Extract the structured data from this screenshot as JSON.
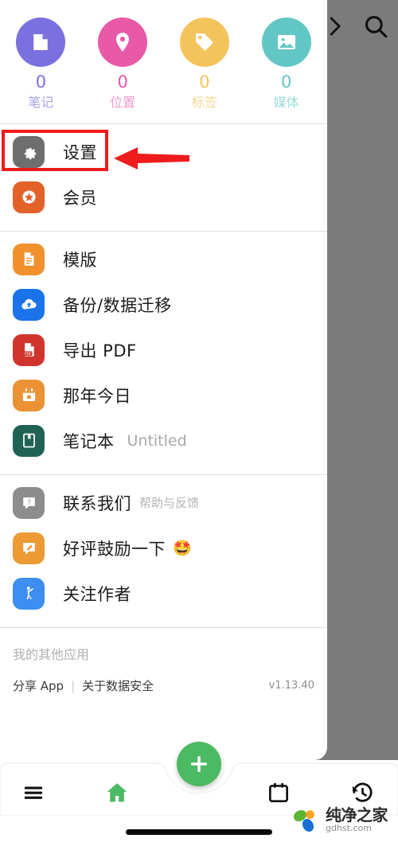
{
  "overlay": {
    "chevron_icon": "chevron-right-icon",
    "search_icon": "search-icon"
  },
  "stats": [
    {
      "icon": "note-icon",
      "count": "0",
      "label": "笔记",
      "color": "#7b70e0",
      "label_color": "#a7a1e6"
    },
    {
      "icon": "location-icon",
      "count": "0",
      "label": "位置",
      "color": "#e85aa8",
      "label_color": "#ef9ccc"
    },
    {
      "icon": "tag-icon",
      "count": "0",
      "label": "标签",
      "color": "#f4c45c",
      "label_color": "#f6d894"
    },
    {
      "icon": "image-icon",
      "count": "0",
      "label": "媒体",
      "color": "#62c6c4",
      "label_color": "#9adcda"
    }
  ],
  "menu_group_1": [
    {
      "icon": "gear-icon",
      "label": "设置",
      "color": "#6e6e6e",
      "highlight": true
    },
    {
      "icon": "star-badge-icon",
      "label": "会员",
      "color": "#e2622a"
    }
  ],
  "menu_group_2": [
    {
      "icon": "template-doc-icon",
      "label": "模版",
      "color": "#f0912e"
    },
    {
      "icon": "cloud-upload-icon",
      "label": "备份/数据迁移",
      "color": "#1a73e8"
    },
    {
      "icon": "pdf-icon",
      "label": "导出 PDF",
      "color": "#d0342c"
    },
    {
      "icon": "calendar-icon",
      "label": "那年今日",
      "color": "#eb9234"
    },
    {
      "icon": "notebook-icon",
      "label": "笔记本",
      "color": "#206355",
      "value": "Untitled"
    }
  ],
  "menu_group_3": [
    {
      "icon": "question-bubble-icon",
      "label": "联系我们",
      "sub": "帮助与反馈",
      "color": "#8d8d8d"
    },
    {
      "icon": "rate-bubble-icon",
      "label": "好评鼓励一下",
      "emoji": "🤩",
      "color": "#eb9a34"
    },
    {
      "icon": "person-wave-icon",
      "label": "关注作者",
      "color": "#3d8ef0"
    }
  ],
  "footer": {
    "other_apps": "我的其他应用",
    "share_app": "分享 App",
    "separator": "|",
    "data_safety": "关于数据安全",
    "version": "v1.13.40"
  },
  "bottom_nav": [
    {
      "icon": "menu-icon",
      "active": false
    },
    {
      "icon": "home-icon",
      "active": true
    },
    {
      "icon": "calendar-outline-icon",
      "active": false
    },
    {
      "icon": "history-icon",
      "active": false
    }
  ],
  "fab": {
    "icon": "plus-icon",
    "color": "#4cb963"
  },
  "annotation": {
    "box_color": "#ef1b1b",
    "arrow_color": "#ee1c1c"
  },
  "watermark": {
    "title": "纯净之家",
    "subtitle": "gdhst.com"
  }
}
